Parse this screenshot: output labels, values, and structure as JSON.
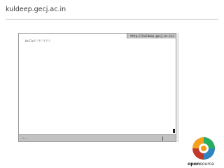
{
  "slide": {
    "title": "kuldeep.gecj.ac.in"
  },
  "terminal": {
    "header_url": "http://kuldeep.gecj.ac.in/",
    "body_text": "hello!!!!!!!!!!",
    "status_left": "-:--"
  },
  "logo": {
    "text_open": "open",
    "text_source": "source",
    "colors": {
      "orange": "#f39c12",
      "green": "#27ae60",
      "blue": "#2e86c1",
      "red": "#c0392b"
    }
  }
}
